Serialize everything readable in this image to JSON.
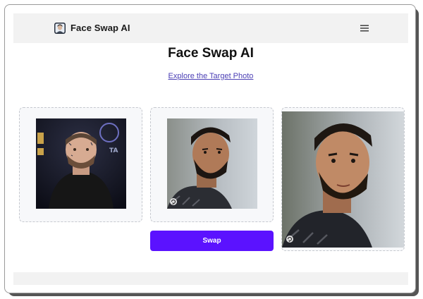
{
  "header": {
    "brand_title": "Face Swap AI",
    "logo_icon": "face-portrait-logo-icon",
    "menu_icon": "hamburger-menu-icon"
  },
  "main": {
    "title": "Face Swap AI",
    "explore_link": "Explore the Target Photo",
    "slots": [
      {
        "role": "source-face",
        "image": "man-tattooed-face-dark-jacket-photo"
      },
      {
        "role": "target-photo",
        "image": "man-beard-short-hair-photo",
        "icon": "refresh-icon"
      },
      {
        "role": "result-photo",
        "image": "swapped-face-result-photo",
        "icon": "refresh-icon"
      }
    ],
    "swap_button": "Swap"
  },
  "colors": {
    "accent": "#5b12ff",
    "link": "#4b3fb5",
    "navbar_bg": "#f2f2f2",
    "slot_border": "#c6c9cf"
  }
}
